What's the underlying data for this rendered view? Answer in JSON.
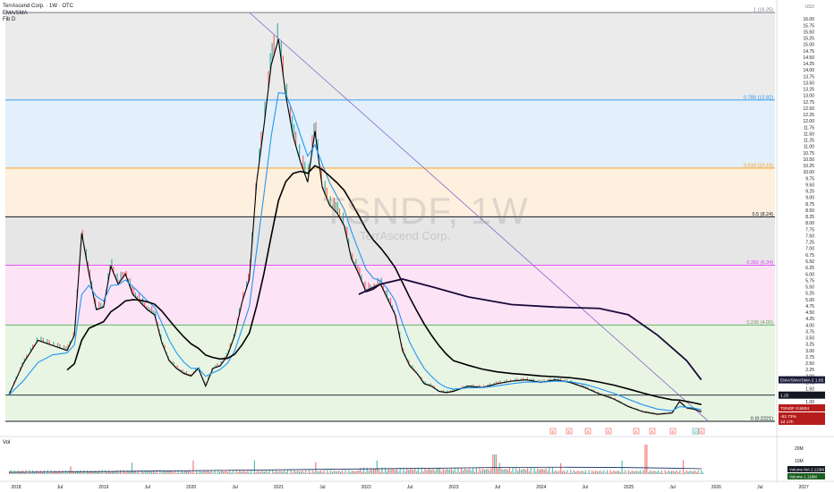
{
  "header": {
    "symbol_line": "TerrAscend Corp. · 1W · OTC",
    "indicator1": "EMA/SMA",
    "indicator2": "Fib D"
  },
  "watermark": {
    "ticker": "TSNDF, 1W",
    "name": "TerrAscend Corp."
  },
  "volume_pane": {
    "label": "Vol"
  },
  "colors": {
    "price_up": "#26a69a",
    "price_down": "#ef5350",
    "ema_fast": "#000000",
    "ema_blue": "#2196f3",
    "sma_long": "#1a0a3a",
    "trendline": "#7e57c2",
    "last_price": "#b71c1c"
  },
  "chart_data": {
    "type": "line",
    "currency": "USD",
    "ylim": [
      0.15,
      16.4
    ],
    "y_ticks": [
      "0.75",
      "1.00",
      "1.25",
      "1.50",
      "1.75",
      "2.00",
      "2.25",
      "2.50",
      "2.75",
      "3.00",
      "3.25",
      "3.50",
      "3.75",
      "4.00",
      "4.25",
      "4.50",
      "4.75",
      "5.00",
      "5.25",
      "5.50",
      "5.75",
      "6.00",
      "6.25",
      "6.50",
      "6.75",
      "7.00",
      "7.25",
      "7.50",
      "7.75",
      "8.00",
      "8.25",
      "8.50",
      "8.75",
      "9.00",
      "9.25",
      "9.50",
      "9.75",
      "10.00",
      "10.25",
      "10.50",
      "10.75",
      "11.00",
      "11.25",
      "11.50",
      "11.75",
      "12.00",
      "12.25",
      "12.50",
      "12.75",
      "13.00",
      "13.25",
      "13.50",
      "13.75",
      "14.00",
      "14.25",
      "14.50",
      "14.75",
      "15.00",
      "15.25",
      "15.50",
      "15.75",
      "16.00"
    ],
    "x_ticks": [
      "2018",
      "Jul",
      "2019",
      "Jul",
      "2020",
      "Jul",
      "2021",
      "Jul",
      "2022",
      "Jul",
      "2023",
      "Jul",
      "2024",
      "Jul",
      "2025",
      "Jul",
      "2026",
      "Jul",
      "2027"
    ],
    "fib_levels": [
      {
        "label": "1 (16.25)",
        "value": 16.25,
        "color": "#787b86"
      },
      {
        "label": "0.786 (12.82)",
        "value": 12.82,
        "color": "#2196f3"
      },
      {
        "label": "0.618 (10.15)",
        "value": 10.15,
        "color": "#ff9800"
      },
      {
        "label": "0.5 (8.24)",
        "value": 8.24,
        "color": "#131722"
      },
      {
        "label": "0.382 (6.34)",
        "value": 6.34,
        "color": "#e040fb"
      },
      {
        "label": "0.236 (4.00)",
        "value": 4.0,
        "color": "#4caf50"
      },
      {
        "label": "0 (0.2221)",
        "value": 0.2221,
        "color": "#131722"
      }
    ],
    "fib_fills": [
      "#ebebeb",
      "#e3f0fb",
      "#fdf0de",
      "#e6e6e6",
      "#fde3f6",
      "#e8f5e3"
    ],
    "horizontal_line": {
      "value": 1.25,
      "label": "1.25"
    },
    "price_series": {
      "name": "TSNDF",
      "x": [
        "2017-12",
        "2018-02",
        "2018-04",
        "2018-06",
        "2018-08",
        "2018-09",
        "2018-10",
        "2018-11",
        "2018-12",
        "2019-01",
        "2019-02",
        "2019-03",
        "2019-04",
        "2019-05",
        "2019-06",
        "2019-07",
        "2019-08",
        "2019-09",
        "2019-10",
        "2019-11",
        "2019-12",
        "2020-01",
        "2020-02",
        "2020-03",
        "2020-04",
        "2020-05",
        "2020-06",
        "2020-07",
        "2020-08",
        "2020-09",
        "2020-10",
        "2020-11",
        "2020-12",
        "2021-01",
        "2021-02",
        "2021-03",
        "2021-04",
        "2021-05",
        "2021-06",
        "2021-07",
        "2021-08",
        "2021-09",
        "2021-10",
        "2021-11",
        "2021-12",
        "2022-01",
        "2022-02",
        "2022-03",
        "2022-04",
        "2022-05",
        "2022-06",
        "2022-07",
        "2022-08",
        "2022-09",
        "2022-10",
        "2022-11",
        "2022-12",
        "2023-01",
        "2023-03",
        "2023-05",
        "2023-07",
        "2023-09",
        "2023-11",
        "2024-01",
        "2024-03",
        "2024-05",
        "2024-07",
        "2024-09",
        "2024-11",
        "2025-01",
        "2025-03",
        "2025-05",
        "2025-07",
        "2025-08",
        "2025-09",
        "2025-10",
        "2025-11"
      ],
      "close": [
        1.25,
        2.5,
        3.4,
        3.2,
        3.0,
        3.6,
        7.6,
        6.0,
        4.6,
        4.7,
        6.3,
        5.6,
        6.0,
        5.2,
        4.9,
        4.6,
        4.4,
        3.3,
        2.6,
        2.3,
        2.1,
        2.0,
        2.3,
        1.6,
        2.3,
        2.4,
        2.8,
        3.6,
        4.9,
        5.8,
        9.6,
        11.8,
        14.2,
        15.2,
        13.0,
        11.4,
        10.4,
        9.6,
        11.6,
        9.4,
        8.7,
        8.4,
        7.9,
        6.6,
        6.0,
        5.3,
        5.4,
        5.6,
        5.0,
        4.4,
        3.0,
        2.4,
        2.1,
        1.7,
        1.6,
        1.4,
        1.35,
        1.4,
        1.6,
        1.55,
        1.7,
        1.8,
        1.85,
        1.75,
        1.85,
        1.75,
        1.55,
        1.3,
        1.1,
        0.8,
        0.6,
        0.5,
        0.55,
        1.0,
        0.75,
        0.7,
        0.5934
      ]
    },
    "series": [
      {
        "name": "EMA/SMA 2",
        "last_value": 1.85
      },
      {
        "name": "EMA/SMA 1",
        "last_value": 0.5379
      }
    ],
    "last_price": {
      "label": "TSNDF",
      "value": "0.5934",
      "change": "-62.73%",
      "countdown": "1d 17h"
    },
    "price_scale_labels": [
      {
        "text": "EMA/SMA/SMA 2",
        "value": "1.85"
      },
      {
        "text": "1.25",
        "value": ""
      },
      {
        "text": "EMA/SMA/SMA 1",
        "value": "0.5379"
      }
    ],
    "volume": {
      "y_ticks": [
        "20M",
        "10M"
      ],
      "ma_label": "Volume MA",
      "ma_value": "2.123M",
      "vol_label": "Volume",
      "vol_value": "1.118M"
    },
    "event_markers": [
      "E",
      "E",
      "E",
      "E",
      "E",
      "E",
      "E",
      "D",
      "E"
    ]
  }
}
